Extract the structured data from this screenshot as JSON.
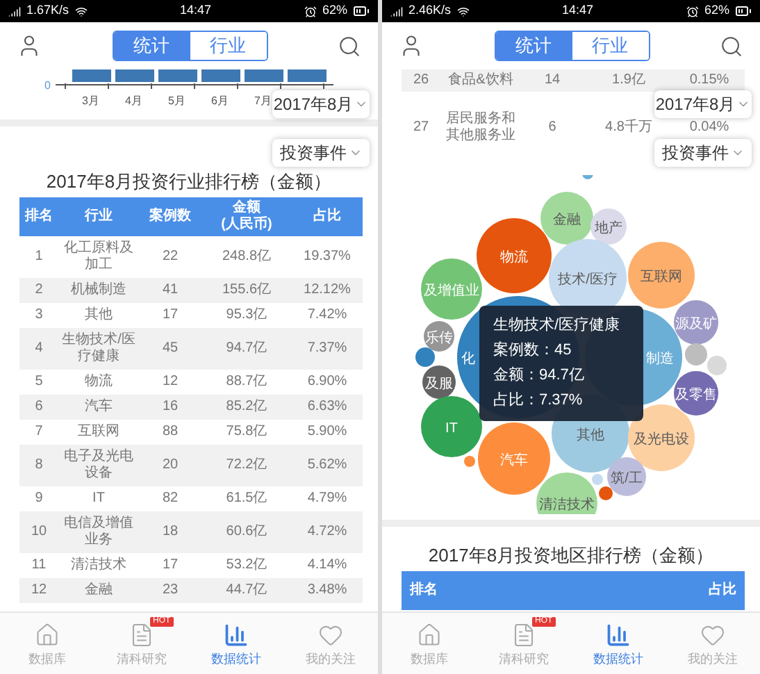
{
  "screens": [
    {
      "status": {
        "speed": "1.67K/s",
        "time": "14:47",
        "battery": "62%"
      },
      "tabs": [
        {
          "label": "统计",
          "selected": true
        },
        {
          "label": "行业",
          "selected": false
        }
      ],
      "dropdowns": [
        "2017年8月",
        "投资事件"
      ],
      "sections": [
        {
          "kind": "mini_chart",
          "y_label": "0",
          "x_labels": [
            "3月",
            "4月",
            "5月",
            "6月",
            "7月"
          ]
        },
        {
          "kind": "ranking",
          "title": "2017年8月投资行业排行榜（金额）",
          "columns": [
            "排名",
            "行业",
            "案例数",
            "金额\n(人民币)",
            "占比"
          ],
          "rows": [
            {
              "cells": [
                "1",
                "化工原料及加工",
                "22",
                "248.8亿",
                "19.37%"
              ],
              "shaded": false
            },
            {
              "cells": [
                "2",
                "机械制造",
                "41",
                "155.6亿",
                "12.12%"
              ],
              "shaded": true
            },
            {
              "cells": [
                "3",
                "其他",
                "17",
                "95.3亿",
                "7.42%"
              ],
              "shaded": false
            },
            {
              "cells": [
                "4",
                "生物技术/医疗健康",
                "45",
                "94.7亿",
                "7.37%"
              ],
              "shaded": true
            },
            {
              "cells": [
                "5",
                "物流",
                "12",
                "88.7亿",
                "6.90%"
              ],
              "shaded": false
            },
            {
              "cells": [
                "6",
                "汽车",
                "16",
                "85.2亿",
                "6.63%"
              ],
              "shaded": true
            },
            {
              "cells": [
                "7",
                "互联网",
                "88",
                "75.8亿",
                "5.90%"
              ],
              "shaded": false
            },
            {
              "cells": [
                "8",
                "电子及光电设备",
                "20",
                "72.2亿",
                "5.62%"
              ],
              "shaded": true
            },
            {
              "cells": [
                "9",
                "IT",
                "82",
                "61.5亿",
                "4.79%"
              ],
              "shaded": false
            },
            {
              "cells": [
                "10",
                "电信及增值业务",
                "18",
                "60.6亿",
                "4.72%"
              ],
              "shaded": true
            },
            {
              "cells": [
                "11",
                "清洁技术",
                "17",
                "53.2亿",
                "4.14%"
              ],
              "shaded": false
            },
            {
              "cells": [
                "12",
                "金融",
                "23",
                "44.7亿",
                "3.48%"
              ],
              "shaded": true
            }
          ]
        }
      ],
      "nav": [
        {
          "label": "数据库",
          "selected": false
        },
        {
          "label": "清科研究",
          "selected": false,
          "badge": "HOT"
        },
        {
          "label": "数据统计",
          "selected": true
        },
        {
          "label": "我的关注",
          "selected": false
        }
      ]
    },
    {
      "status": {
        "speed": "2.46K/s",
        "time": "14:47",
        "battery": "62%"
      },
      "tabs": [
        {
          "label": "统计",
          "selected": true
        },
        {
          "label": "行业",
          "selected": false
        }
      ],
      "dropdowns": [
        "2017年8月",
        "投资事件"
      ],
      "sections": [
        {
          "kind": "table_fragment",
          "rows": [
            {
              "cells": [
                "26",
                "食品&饮料",
                "14",
                "1.9亿",
                "0.15%"
              ],
              "shaded": true
            },
            {
              "cells": [
                "27",
                "居民服务和其他服务业",
                "6",
                "4.8千万",
                "0.04%"
              ],
              "shaded": false
            }
          ]
        },
        {
          "kind": "bubble_chart",
          "bubbles": [
            {
              "label": "金融",
              "color": "#a1d99b"
            },
            {
              "label": "地产",
              "color": "#dadaeb"
            },
            {
              "label": "物流",
              "color": "#e6550d"
            },
            {
              "label": "技术/医疗",
              "color": "#c6dbef"
            },
            {
              "label": "互联网",
              "color": "#fdae6b"
            },
            {
              "label": "及增值业",
              "color": "#74c476"
            },
            {
              "label": "化",
              "color": "#3182bd"
            },
            {
              "label": "制造",
              "color": "#6baed6"
            },
            {
              "label": "源及矿",
              "color": "#9e9ac8"
            },
            {
              "label": "乐传",
              "color": "#969696"
            },
            {
              "label": "及服",
              "color": "#636363"
            },
            {
              "label": "及零售",
              "color": "#756bb1"
            },
            {
              "label": "IT",
              "color": "#31a354"
            },
            {
              "label": "其他",
              "color": "#9ecae1"
            },
            {
              "label": "及光电设",
              "color": "#fdd0a2"
            },
            {
              "label": "汽车",
              "color": "#fd8d3c"
            },
            {
              "label": "筑/工",
              "color": "#bcbddc"
            },
            {
              "label": "清洁技术",
              "color": "#a1d99b"
            },
            {
              "color": "#3182bd"
            },
            {
              "color": "#bdbdbd"
            },
            {
              "color": "#d9d9d9"
            },
            {
              "color": "#6baed6"
            },
            {
              "color": "#fd8d3c"
            },
            {
              "color": "#e6550d"
            },
            {
              "color": "#c6dbef"
            }
          ],
          "tooltip": [
            "生物技术/医疗健康",
            "案例数：45",
            "金额：94.7亿",
            "占比：7.37%"
          ]
        },
        {
          "kind": "ranking",
          "title": "2017年8月投资地区排行榜（金额）",
          "columns": [
            "排名",
            "占比"
          ]
        }
      ],
      "nav": [
        {
          "label": "数据库",
          "selected": false
        },
        {
          "label": "清科研究",
          "selected": false,
          "badge": "HOT"
        },
        {
          "label": "数据统计",
          "selected": true
        },
        {
          "label": "我的关注",
          "selected": false
        }
      ]
    }
  ]
}
